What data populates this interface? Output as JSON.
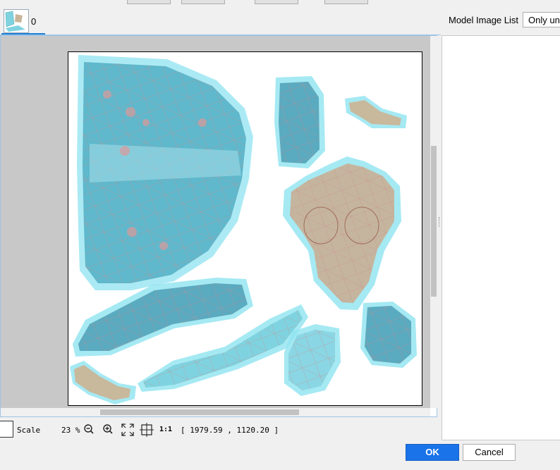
{
  "tabs": [
    {
      "label": "0"
    }
  ],
  "right_panel": {
    "label": "Model Image List",
    "filter_value": "Only un"
  },
  "status": {
    "scale_label": "Scale",
    "zoom": "23 %",
    "actual_size_label": "1:1",
    "coords": "[ 1979.59 , 1120.20 ]"
  },
  "buttons": {
    "ok": "OK",
    "cancel": "Cancel"
  },
  "colors": {
    "accent": "#1a73e8",
    "uv_fill": "#8fe3f0",
    "mesh_line": "#c77a7a"
  },
  "icons": [
    "zoom-out-icon",
    "zoom-in-icon",
    "fit-view-icon",
    "center-icon"
  ]
}
